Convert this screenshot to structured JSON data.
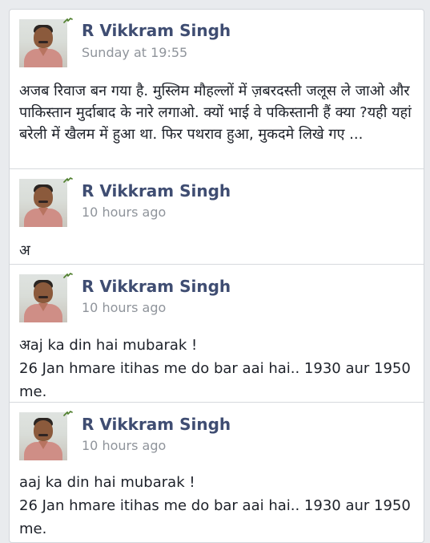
{
  "posts": [
    {
      "author": "R Vikkram Singh",
      "timestamp": "Sunday at 19:55",
      "body": "अजब रिवाज बन गया है. मुस्लिम मौहल्लों में ज़बरदस्ती जलूस ले जाओ और पाकिस्तान मुर्दाबाद के नारे लगाओ. क्यों भाई वे पकिस्तानी हैं क्या ?यही यहां बरेली में खैलम में हुआ था. फिर पथराव हुआ, मुकदमे लिखे गए ..."
    },
    {
      "author": "R Vikkram Singh",
      "timestamp": "10 hours ago",
      "body": "अ"
    },
    {
      "author": "R Vikkram Singh",
      "timestamp": "10 hours ago",
      "body": "अaj ka din hai mubarak !\n26 Jan hmare itihas me do bar aai hai.. 1930 aur 1950 me."
    },
    {
      "author": "R Vikkram Singh",
      "timestamp": "10 hours ago",
      "body": "aaj ka din hai mubarak !\n26 Jan hmare itihas me do bar aai hai.. 1930 aur 1950 me."
    }
  ],
  "icons": {
    "avatar": "profile-photo",
    "mark": "small-leaf-icon"
  }
}
